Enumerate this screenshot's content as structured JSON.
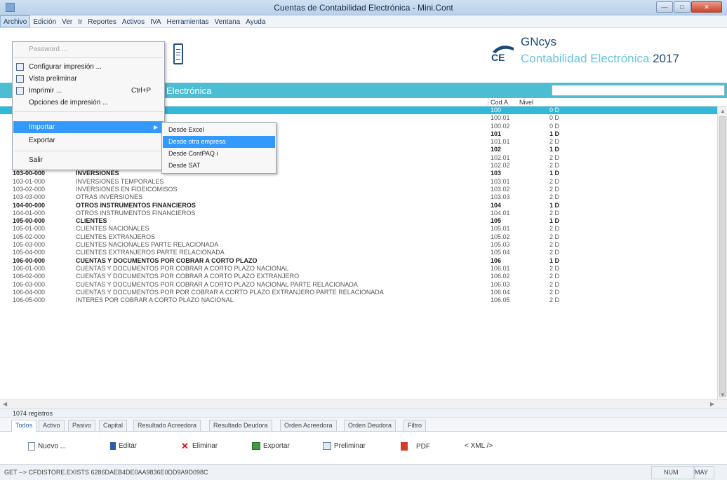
{
  "window": {
    "title": "Cuentas de Contabilidad Electrónica - Mini.Cont",
    "min_label": "—",
    "max_label": "□",
    "close_label": "✕"
  },
  "menubar": [
    "Archivo",
    "Edición",
    "Ver",
    "Ir",
    "Reportes",
    "Activos",
    "IVA",
    "Herramientas",
    "Ventana",
    "Ayuda"
  ],
  "logo": {
    "brand": "GNcys",
    "mark": "CE",
    "product": "Contabilidad Electrónica",
    "year": "2017"
  },
  "section_title": "Electrónica",
  "search": {
    "value": ""
  },
  "grid": {
    "headers": {
      "cod": "Cod.A.",
      "nivel": "Nivel"
    },
    "rows": [
      {
        "code": "",
        "name": "",
        "cod": "100",
        "nivel": "0 D",
        "bold": false,
        "sel": true
      },
      {
        "code": "",
        "name": "",
        "cod": "100.01",
        "nivel": "0 D",
        "bold": false,
        "sel": false
      },
      {
        "code": "",
        "name": "",
        "cod": "100.02",
        "nivel": "0 D",
        "bold": false,
        "sel": false
      },
      {
        "code": "",
        "name": "",
        "cod": "101",
        "nivel": "1 D",
        "bold": true,
        "sel": false
      },
      {
        "code": "",
        "name": "",
        "cod": "101.01",
        "nivel": "2 D",
        "bold": false,
        "sel": false
      },
      {
        "code": "102-00-000",
        "name": "BANCOS",
        "cod": "102",
        "nivel": "1 D",
        "bold": true,
        "sel": false
      },
      {
        "code": "102-01-000",
        "name": "BANCOS NACIONALES",
        "cod": "102.01",
        "nivel": "2 D",
        "bold": false,
        "sel": false
      },
      {
        "code": "102-02-000",
        "name": "BANCOS EXTRANJEROS",
        "cod": "102.02",
        "nivel": "2 D",
        "bold": false,
        "sel": false
      },
      {
        "code": "103-00-000",
        "name": "INVERSIONES",
        "cod": "103",
        "nivel": "1 D",
        "bold": true,
        "sel": false
      },
      {
        "code": "103-01-000",
        "name": "INVERSIONES TEMPORALES",
        "cod": "103.01",
        "nivel": "2 D",
        "bold": false,
        "sel": false
      },
      {
        "code": "103-02-000",
        "name": "INVERSIONES EN FIDEICOMISOS",
        "cod": "103.02",
        "nivel": "2 D",
        "bold": false,
        "sel": false
      },
      {
        "code": "103-03-000",
        "name": "OTRAS INVERSIONES",
        "cod": "103.03",
        "nivel": "2 D",
        "bold": false,
        "sel": false
      },
      {
        "code": "104-00-000",
        "name": "OTROS INSTRUMENTOS FINANCIEROS",
        "cod": "104",
        "nivel": "1 D",
        "bold": true,
        "sel": false
      },
      {
        "code": "104-01-000",
        "name": "OTROS INSTRUMENTOS FINANCIEROS",
        "cod": "104.01",
        "nivel": "2 D",
        "bold": false,
        "sel": false
      },
      {
        "code": "105-00-000",
        "name": "CLIENTES",
        "cod": "105",
        "nivel": "1 D",
        "bold": true,
        "sel": false
      },
      {
        "code": "105-01-000",
        "name": "CLIENTES NACIONALES",
        "cod": "105.01",
        "nivel": "2 D",
        "bold": false,
        "sel": false
      },
      {
        "code": "105-02-000",
        "name": "CLIENTES EXTRANJEROS",
        "cod": "105.02",
        "nivel": "2 D",
        "bold": false,
        "sel": false
      },
      {
        "code": "105-03-000",
        "name": "CLIENTES NACIONALES PARTE RELACIONADA",
        "cod": "105.03",
        "nivel": "2 D",
        "bold": false,
        "sel": false
      },
      {
        "code": "105-04-000",
        "name": "CLIENTES EXTRANJEROS PARTE RELACIONADA",
        "cod": "105.04",
        "nivel": "2 D",
        "bold": false,
        "sel": false
      },
      {
        "code": "106-00-000",
        "name": "CUENTAS Y DOCUMENTOS POR COBRAR A CORTO PLAZO",
        "cod": "106",
        "nivel": "1 D",
        "bold": true,
        "sel": false
      },
      {
        "code": "106-01-000",
        "name": "CUENTAS Y DOCUMENTOS POR COBRAR A CORTO PLAZO NACIONAL",
        "cod": "106.01",
        "nivel": "2 D",
        "bold": false,
        "sel": false
      },
      {
        "code": "106-02-000",
        "name": "CUENTAS Y DOCUMENTOS POR COBRAR A CORTO PLAZO EXTRANJERO",
        "cod": "106.02",
        "nivel": "2 D",
        "bold": false,
        "sel": false
      },
      {
        "code": "106-03-000",
        "name": "CUENTAS Y DOCUMENTOS POR COBRAR A CORTO PLAZO NACIONAL PARTE RELACIONADA",
        "cod": "106.03",
        "nivel": "2 D",
        "bold": false,
        "sel": false
      },
      {
        "code": "106-04-000",
        "name": "CUENTAS Y DOCUMENTOS POR POR COBRAR A CORTO PLAZO EXTRANJERO PARTE RELACIONADA",
        "cod": "106.04",
        "nivel": "2 D",
        "bold": false,
        "sel": false
      },
      {
        "code": "106-05-000",
        "name": "INTERES POR COBRAR A CORTO PLAZO NACIONAL",
        "cod": "106.05",
        "nivel": "2 D",
        "bold": false,
        "sel": false
      }
    ]
  },
  "scroll": {
    "up": "▲",
    "down": "▼",
    "left": "◀",
    "right": "▶"
  },
  "record_count": "1074 registros",
  "tabs": [
    "Todos",
    "Activo",
    "Pasivo",
    "Capital",
    "Resultado Acreedora",
    "Resultado Deudora",
    "Orden Acreedora",
    "Orden Deudora",
    "Filtro"
  ],
  "actions": {
    "nuevo": "Nuevo ...",
    "editar": "Editar",
    "eliminar": "Eliminar",
    "exportar": "Exportar",
    "preliminar": "Preliminar",
    "pdf": "PDF",
    "xml": "< XML />"
  },
  "statusbar": {
    "message": "GET --> CFDISTORE.EXISTS 6286DAEB4DE0AA9836E0DD9A9D098C",
    "num": "NUM",
    "may": "MAY"
  },
  "file_menu": {
    "items": [
      {
        "label": "Password ...",
        "disabled": true
      },
      {
        "label": "Configurar impresión ...",
        "icon": true
      },
      {
        "label": "Vista preliminar",
        "icon": true
      },
      {
        "label": "Imprimir ...",
        "shortcut": "Ctrl+P",
        "icon": true
      },
      {
        "label": "Opciones de impresión ..."
      },
      {
        "label": "Importar",
        "submenu": true,
        "highlight": true
      },
      {
        "label": "Exportar"
      },
      {
        "label": "Salir"
      }
    ]
  },
  "import_submenu": [
    "Desde Excel",
    "Desde otra empresa",
    "Desde ContPAQ i",
    "Desde SAT"
  ]
}
